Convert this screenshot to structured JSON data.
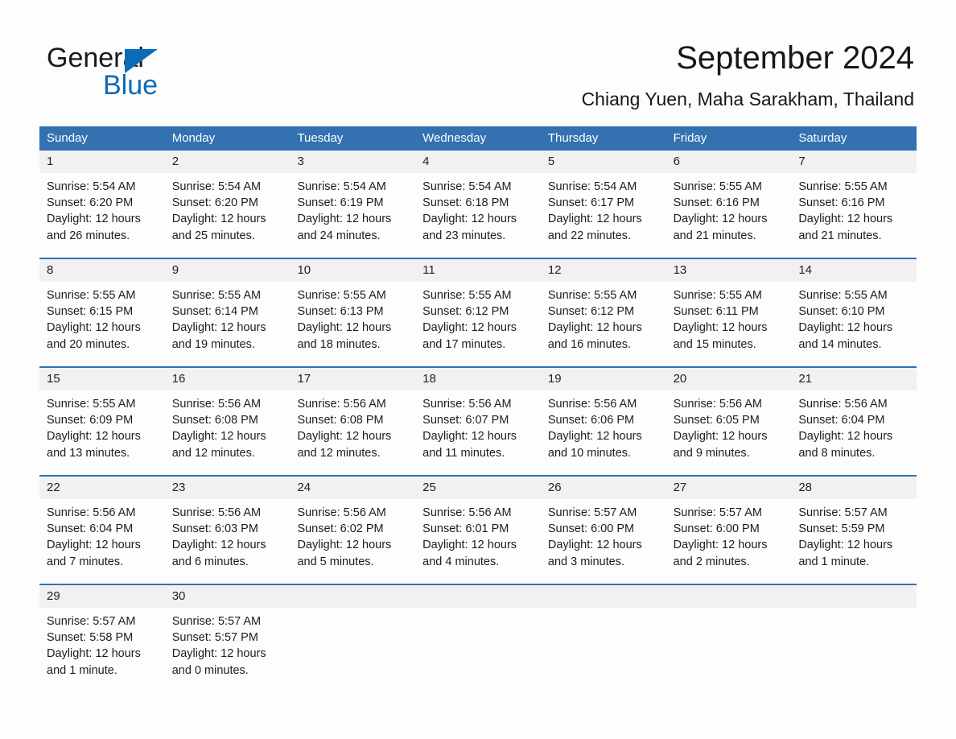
{
  "brand": {
    "name_part1": "General",
    "name_part2": "Blue",
    "triangle_color": "#0d6bb5",
    "accent_color": "#3371b0"
  },
  "header": {
    "title": "September 2024",
    "location": "Chiang Yuen, Maha Sarakham, Thailand"
  },
  "calendar": {
    "weekday_headers": [
      "Sunday",
      "Monday",
      "Tuesday",
      "Wednesday",
      "Thursday",
      "Friday",
      "Saturday"
    ],
    "weeks": [
      [
        {
          "date": "1",
          "sunrise": "Sunrise: 5:54 AM",
          "sunset": "Sunset: 6:20 PM",
          "daylight": "Daylight: 12 hours and 26 minutes."
        },
        {
          "date": "2",
          "sunrise": "Sunrise: 5:54 AM",
          "sunset": "Sunset: 6:20 PM",
          "daylight": "Daylight: 12 hours and 25 minutes."
        },
        {
          "date": "3",
          "sunrise": "Sunrise: 5:54 AM",
          "sunset": "Sunset: 6:19 PM",
          "daylight": "Daylight: 12 hours and 24 minutes."
        },
        {
          "date": "4",
          "sunrise": "Sunrise: 5:54 AM",
          "sunset": "Sunset: 6:18 PM",
          "daylight": "Daylight: 12 hours and 23 minutes."
        },
        {
          "date": "5",
          "sunrise": "Sunrise: 5:54 AM",
          "sunset": "Sunset: 6:17 PM",
          "daylight": "Daylight: 12 hours and 22 minutes."
        },
        {
          "date": "6",
          "sunrise": "Sunrise: 5:55 AM",
          "sunset": "Sunset: 6:16 PM",
          "daylight": "Daylight: 12 hours and 21 minutes."
        },
        {
          "date": "7",
          "sunrise": "Sunrise: 5:55 AM",
          "sunset": "Sunset: 6:16 PM",
          "daylight": "Daylight: 12 hours and 21 minutes."
        }
      ],
      [
        {
          "date": "8",
          "sunrise": "Sunrise: 5:55 AM",
          "sunset": "Sunset: 6:15 PM",
          "daylight": "Daylight: 12 hours and 20 minutes."
        },
        {
          "date": "9",
          "sunrise": "Sunrise: 5:55 AM",
          "sunset": "Sunset: 6:14 PM",
          "daylight": "Daylight: 12 hours and 19 minutes."
        },
        {
          "date": "10",
          "sunrise": "Sunrise: 5:55 AM",
          "sunset": "Sunset: 6:13 PM",
          "daylight": "Daylight: 12 hours and 18 minutes."
        },
        {
          "date": "11",
          "sunrise": "Sunrise: 5:55 AM",
          "sunset": "Sunset: 6:12 PM",
          "daylight": "Daylight: 12 hours and 17 minutes."
        },
        {
          "date": "12",
          "sunrise": "Sunrise: 5:55 AM",
          "sunset": "Sunset: 6:12 PM",
          "daylight": "Daylight: 12 hours and 16 minutes."
        },
        {
          "date": "13",
          "sunrise": "Sunrise: 5:55 AM",
          "sunset": "Sunset: 6:11 PM",
          "daylight": "Daylight: 12 hours and 15 minutes."
        },
        {
          "date": "14",
          "sunrise": "Sunrise: 5:55 AM",
          "sunset": "Sunset: 6:10 PM",
          "daylight": "Daylight: 12 hours and 14 minutes."
        }
      ],
      [
        {
          "date": "15",
          "sunrise": "Sunrise: 5:55 AM",
          "sunset": "Sunset: 6:09 PM",
          "daylight": "Daylight: 12 hours and 13 minutes."
        },
        {
          "date": "16",
          "sunrise": "Sunrise: 5:56 AM",
          "sunset": "Sunset: 6:08 PM",
          "daylight": "Daylight: 12 hours and 12 minutes."
        },
        {
          "date": "17",
          "sunrise": "Sunrise: 5:56 AM",
          "sunset": "Sunset: 6:08 PM",
          "daylight": "Daylight: 12 hours and 12 minutes."
        },
        {
          "date": "18",
          "sunrise": "Sunrise: 5:56 AM",
          "sunset": "Sunset: 6:07 PM",
          "daylight": "Daylight: 12 hours and 11 minutes."
        },
        {
          "date": "19",
          "sunrise": "Sunrise: 5:56 AM",
          "sunset": "Sunset: 6:06 PM",
          "daylight": "Daylight: 12 hours and 10 minutes."
        },
        {
          "date": "20",
          "sunrise": "Sunrise: 5:56 AM",
          "sunset": "Sunset: 6:05 PM",
          "daylight": "Daylight: 12 hours and 9 minutes."
        },
        {
          "date": "21",
          "sunrise": "Sunrise: 5:56 AM",
          "sunset": "Sunset: 6:04 PM",
          "daylight": "Daylight: 12 hours and 8 minutes."
        }
      ],
      [
        {
          "date": "22",
          "sunrise": "Sunrise: 5:56 AM",
          "sunset": "Sunset: 6:04 PM",
          "daylight": "Daylight: 12 hours and 7 minutes."
        },
        {
          "date": "23",
          "sunrise": "Sunrise: 5:56 AM",
          "sunset": "Sunset: 6:03 PM",
          "daylight": "Daylight: 12 hours and 6 minutes."
        },
        {
          "date": "24",
          "sunrise": "Sunrise: 5:56 AM",
          "sunset": "Sunset: 6:02 PM",
          "daylight": "Daylight: 12 hours and 5 minutes."
        },
        {
          "date": "25",
          "sunrise": "Sunrise: 5:56 AM",
          "sunset": "Sunset: 6:01 PM",
          "daylight": "Daylight: 12 hours and 4 minutes."
        },
        {
          "date": "26",
          "sunrise": "Sunrise: 5:57 AM",
          "sunset": "Sunset: 6:00 PM",
          "daylight": "Daylight: 12 hours and 3 minutes."
        },
        {
          "date": "27",
          "sunrise": "Sunrise: 5:57 AM",
          "sunset": "Sunset: 6:00 PM",
          "daylight": "Daylight: 12 hours and 2 minutes."
        },
        {
          "date": "28",
          "sunrise": "Sunrise: 5:57 AM",
          "sunset": "Sunset: 5:59 PM",
          "daylight": "Daylight: 12 hours and 1 minute."
        }
      ],
      [
        {
          "date": "29",
          "sunrise": "Sunrise: 5:57 AM",
          "sunset": "Sunset: 5:58 PM",
          "daylight": "Daylight: 12 hours and 1 minute."
        },
        {
          "date": "30",
          "sunrise": "Sunrise: 5:57 AM",
          "sunset": "Sunset: 5:57 PM",
          "daylight": "Daylight: 12 hours and 0 minutes."
        },
        {
          "date": "",
          "sunrise": "",
          "sunset": "",
          "daylight": ""
        },
        {
          "date": "",
          "sunrise": "",
          "sunset": "",
          "daylight": ""
        },
        {
          "date": "",
          "sunrise": "",
          "sunset": "",
          "daylight": ""
        },
        {
          "date": "",
          "sunrise": "",
          "sunset": "",
          "daylight": ""
        },
        {
          "date": "",
          "sunrise": "",
          "sunset": "",
          "daylight": ""
        }
      ]
    ]
  }
}
